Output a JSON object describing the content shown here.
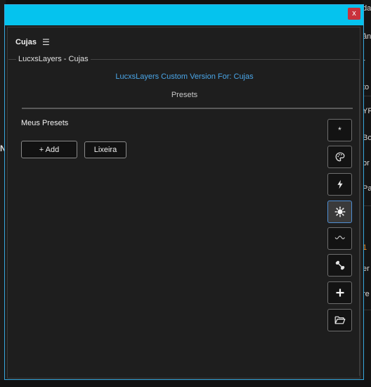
{
  "window": {
    "close_label": "x"
  },
  "panel": {
    "title": "Cujas",
    "menu_icon": "hamburger-icon"
  },
  "group": {
    "legend": "LucxsLayers - Cujas",
    "version_text": "LucxsLayers Custom Version For: Cujas",
    "section_label": "Presets"
  },
  "presets": {
    "heading": "Meus Presets",
    "add_label": "+ Add",
    "trash_label": "Lixeira"
  },
  "side_toolbar": {
    "items": [
      {
        "icon": "asterisk-icon",
        "label": "*"
      },
      {
        "icon": "palette-icon"
      },
      {
        "icon": "lightning-icon"
      },
      {
        "icon": "sun-gear-icon",
        "active": true
      },
      {
        "icon": "wave-icon"
      },
      {
        "icon": "bone-icon"
      },
      {
        "icon": "plus-icon"
      },
      {
        "icon": "folder-open-icon"
      }
    ]
  },
  "background_fragments": [
    "da",
    "ân",
    "r",
    "to",
    "YR",
    "Bo",
    "br",
    "Pa",
    "1",
    "er",
    "re"
  ],
  "background_left_fragment": "N",
  "colors": {
    "titlebar": "#05c3ee",
    "close_button": "#c8323c",
    "window_border": "#37a7dc",
    "version_text": "#4aa6e8",
    "background_accent": "#f08a24"
  }
}
